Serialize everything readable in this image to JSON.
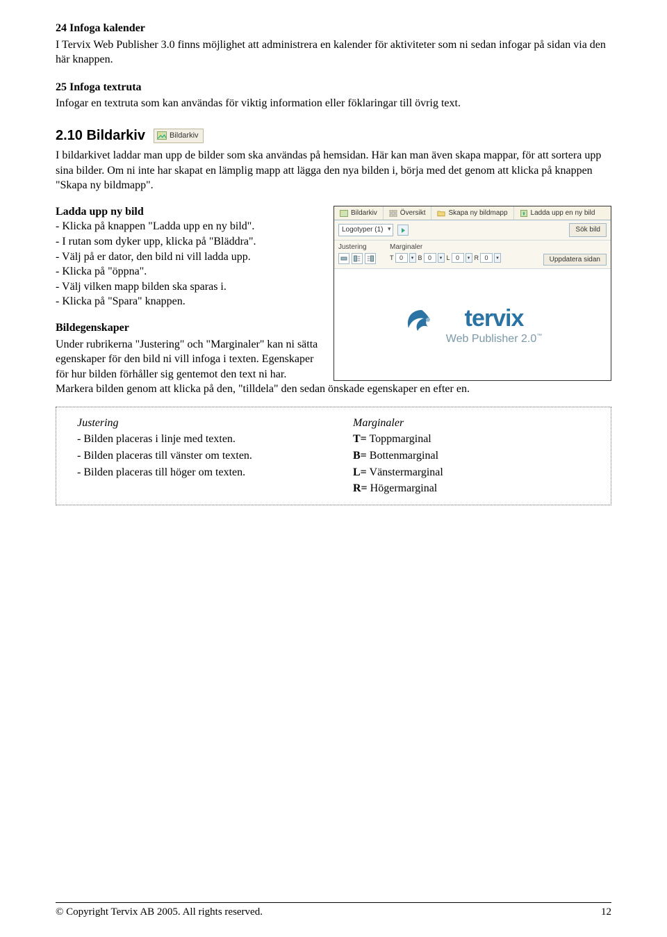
{
  "s24": {
    "title": "24 Infoga kalender",
    "body": "I Tervix Web Publisher 3.0 finns möjlighet att administrera en kalender för aktiviteter som ni sedan infogar på sidan via den här knappen."
  },
  "s25": {
    "title": "25 Infoga textruta",
    "body": "Infogar en textruta som kan användas för viktig information eller föklaringar till övrig text."
  },
  "s210": {
    "title": "2.10  Bildarkiv",
    "btn_label": "Bildarkiv",
    "body": "I bildarkivet laddar man upp de bilder som ska användas på hemsidan. Här kan man även skapa mappar, för att sortera upp sina bilder. Om ni inte har skapat en lämplig mapp att lägga den nya bilden i, börja med det genom att klicka på knappen \"Skapa ny bildmapp\"."
  },
  "ladda": {
    "title": "Ladda upp ny bild",
    "items": [
      "- Klicka på knappen \"Ladda upp en ny bild\".",
      "- I rutan som dyker upp, klicka på \"Bläddra\".",
      "- Välj på er dator, den bild ni vill ladda upp.",
      "- Klicka på \"öppna\".",
      "- Välj vilken mapp bilden ska sparas i.",
      "- Klicka på \"Spara\" knappen."
    ]
  },
  "bilde": {
    "title": "Bildegenskaper",
    "body": "Under rubrikerna \"Justering\" och \"Marginaler\" kan ni sätta egenskaper för den bild ni vill infoga i texten. Egenskaper för hur bilden förhåller sig gentemot den text ni har. Markera bilden genom att klicka på den, \"tilldela\" den sedan önskade egenskaper en efter en."
  },
  "box": {
    "left": {
      "title": "Justering",
      "items": [
        "- Bilden placeras i linje med texten.",
        "- Bilden placeras till vänster om texten.",
        "- Bilden placeras till höger om texten."
      ]
    },
    "right": {
      "title": "Marginaler",
      "items": [
        "T= Toppmarginal",
        "B= Bottenmarginal",
        "L= Vänstermarginal",
        "R= Högermarginal"
      ]
    }
  },
  "figure": {
    "tabs": [
      "Bildarkiv",
      "Översikt",
      "Skapa ny bildmapp",
      "Ladda upp en ny bild"
    ],
    "select": "Logotyper (1)",
    "search_btn": "Sök bild",
    "col_just": "Justering",
    "col_marg": "Marginaler",
    "marg_labels": [
      "T",
      "B",
      "L",
      "R"
    ],
    "marg_values": [
      "0",
      "0",
      "0",
      "0"
    ],
    "update_btn": "Uppdatera sidan",
    "logo_line1": "tervix",
    "logo_line2": "Web Publisher 2.0",
    "logo_tm": "™"
  },
  "footer": {
    "copyright": "© Copyright Tervix AB 2005. All rights reserved.",
    "page": "12"
  }
}
